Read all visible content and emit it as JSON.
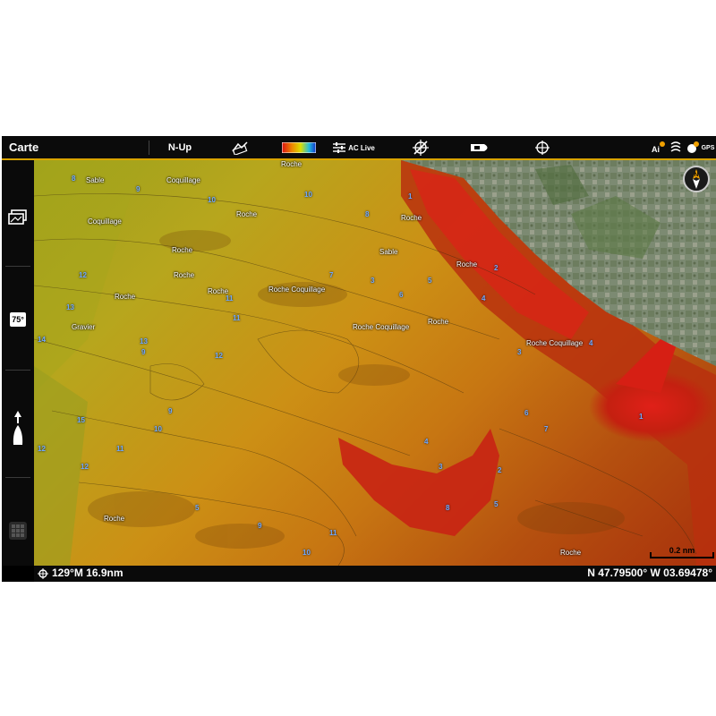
{
  "topbar": {
    "title": "Carte",
    "orientation": "N-Up",
    "ac_live": "AC Live",
    "gps": "GPS"
  },
  "sidebar": {
    "temperature": "75°"
  },
  "map": {
    "compass_letter": "N",
    "scale": "0.2 nm",
    "bottom_labels": {
      "roche_bottom_right": "Roche"
    },
    "labels": [
      {
        "text": "Roche",
        "id": "l0"
      },
      {
        "text": "Sable",
        "id": "l1"
      },
      {
        "text": "Coquillage",
        "id": "l2"
      },
      {
        "text": "Roche",
        "id": "l3"
      },
      {
        "text": "Coquillage",
        "id": "l4"
      },
      {
        "text": "Roche",
        "id": "l5"
      },
      {
        "text": "Sable",
        "id": "l6"
      },
      {
        "text": "Roche",
        "id": "l7"
      },
      {
        "text": "Roche",
        "id": "l8"
      },
      {
        "text": "Roche",
        "id": "l9"
      },
      {
        "text": "Roche",
        "id": "l10"
      },
      {
        "text": "Roche",
        "id": "l11"
      },
      {
        "text": "Roche Coquillage",
        "id": "l12"
      },
      {
        "text": "Roche Coquillage",
        "id": "l13"
      },
      {
        "text": "Roche",
        "id": "l14"
      },
      {
        "text": "Gravier",
        "id": "l15"
      },
      {
        "text": "Roche Coquillage",
        "id": "l16"
      },
      {
        "text": "Roche",
        "id": "l17"
      },
      {
        "text": "Roche",
        "id": "l18"
      }
    ],
    "depths": [
      "8",
      "9",
      "10",
      "11",
      "12",
      "13",
      "14",
      "15",
      "1",
      "2",
      "3",
      "4",
      "5",
      "6",
      "7",
      "8",
      "9",
      "10",
      "11",
      "12",
      "13",
      "9",
      "10",
      "11",
      "12",
      "9",
      "10",
      "11",
      "12",
      "3",
      "4",
      "5",
      "6",
      "7",
      "8",
      "1",
      "2",
      "3",
      "4",
      "5"
    ]
  },
  "bottombar": {
    "heading_distance": "129°M  16.9nm",
    "coordinates": "N 47.79500° W 03.69478°"
  },
  "colors": {
    "accent": "#d9a400",
    "depth_label": "#6fa8ff"
  }
}
